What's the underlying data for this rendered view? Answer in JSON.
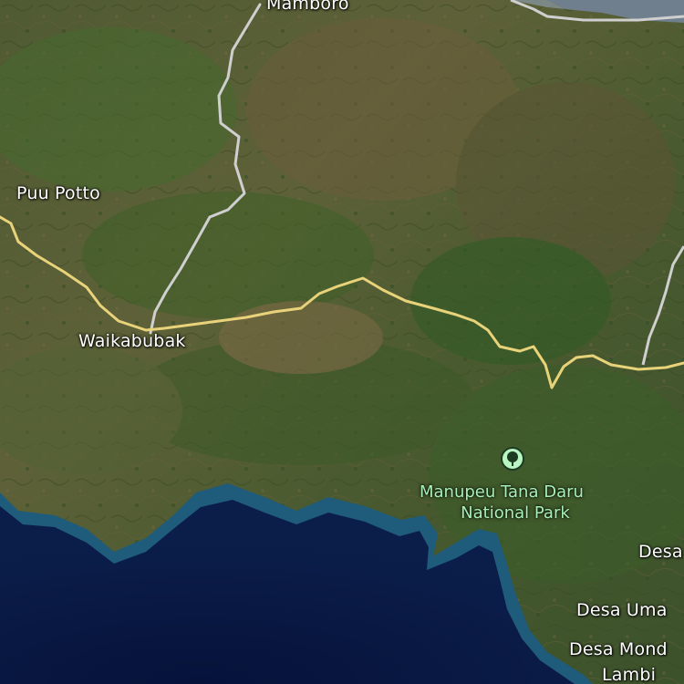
{
  "map": {
    "labels": {
      "mamboro": "Mamboro",
      "puu_potto": "Puu Potto",
      "waikabubak": "Waikabubak",
      "desa_top_right": "Desa",
      "desa_uma": "Desa Uma",
      "desa_mond": "Desa Mond",
      "lambi": "Lambi"
    },
    "park": {
      "name_line1": "Manupeu Tana Daru",
      "name_line2": "National Park",
      "icon": "tree-icon"
    },
    "colors": {
      "main_road": "#e8d27a",
      "secondary_road": "#cfcfcf",
      "ocean": "#0a1a3e",
      "coast_shallow": "#1f5b7a",
      "park_label": "#a8f0b8"
    }
  }
}
